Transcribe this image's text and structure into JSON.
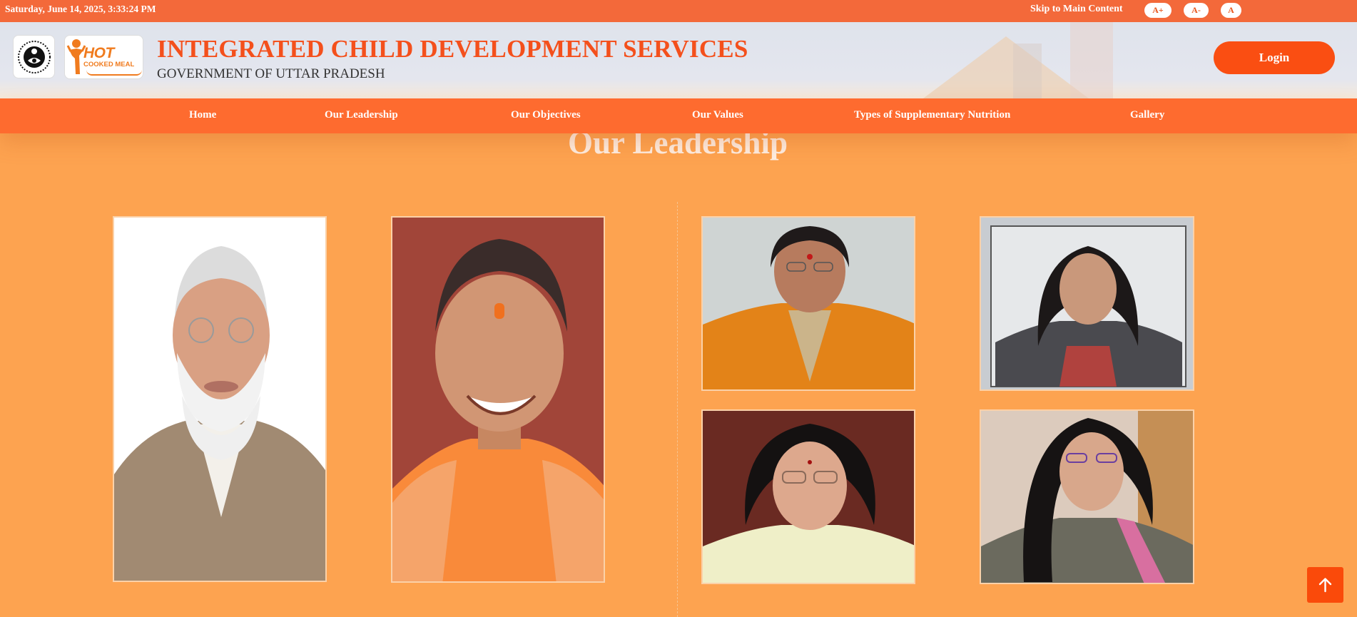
{
  "topbar": {
    "datetime": "Saturday, June 14, 2025, 3:33:24 PM",
    "skip_link": "Skip to Main Content",
    "font_increase": "A+",
    "font_decrease": "A-",
    "font_reset": "A"
  },
  "header": {
    "logo_icds_icon": "icds-emblem-icon",
    "logo_hcm_hot": "HOT",
    "logo_hcm_sub": "COOKED MEAL",
    "title": "INTEGRATED CHILD DEVELOPMENT SERVICES",
    "subtitle": "GOVERNMENT OF UTTAR PRADESH",
    "login_label": "Login"
  },
  "nav": {
    "items": [
      {
        "label": "Home"
      },
      {
        "label": "Our Leadership"
      },
      {
        "label": "Our Objectives"
      },
      {
        "label": "Our Values"
      },
      {
        "label": "Types of Supplementary Nutrition"
      },
      {
        "label": "Gallery"
      }
    ]
  },
  "leadership": {
    "title": "Our Leadership"
  },
  "colors": {
    "topbar": "#f3693a",
    "nav": "#fe6b2f",
    "page_bg": "#fda350",
    "accent": "#f4501c",
    "login": "#fa4e12"
  },
  "back_to_top_icon": "arrow-up-icon"
}
